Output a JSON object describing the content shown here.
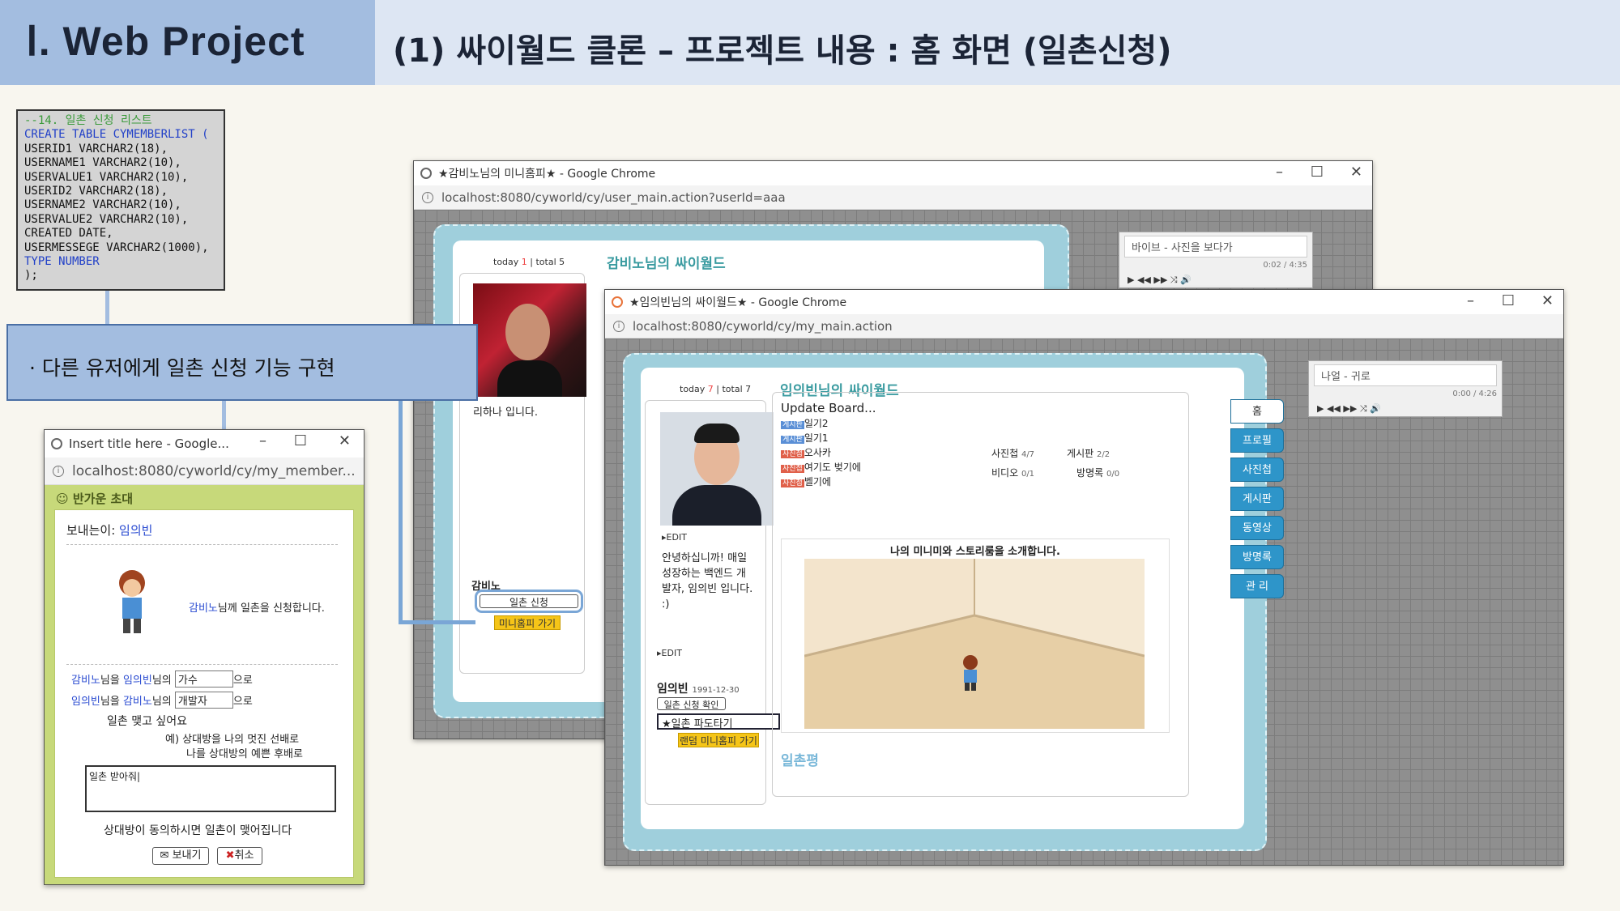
{
  "header": {
    "section": "Ⅰ. Web Project",
    "title": "(1) 싸이월드 클론 – 프로젝트 내용 : 홈 화면 (일촌신청)"
  },
  "sql": {
    "lines": [
      "--14. 일촌 신청 리스트",
      "CREATE TABLE CYMEMBERLIST (",
      "USERID1 VARCHAR2(18),",
      "USERNAME1 VARCHAR2(10),",
      "USERVALUE1 VARCHAR2(10),",
      "USERID2 VARCHAR2(18),",
      "USERNAME2 VARCHAR2(10),",
      "USERVALUE2 VARCHAR2(10),",
      "CREATED DATE,",
      "USERMESSEGE VARCHAR2(1000),",
      "TYPE NUMBER",
      ");"
    ]
  },
  "callout": {
    "text": "· 다른 유저에게 일촌 신청 기능 구현"
  },
  "popup": {
    "title": "Insert title here - Google...",
    "url": "localhost:8080/cyworld/cy/my_member...",
    "heading": "반가운 초대",
    "sender_label": "보내는이:",
    "sender_name": "임의빈",
    "invite_text": "님께 일촌을 신청합니다.",
    "invite_target": "감비노",
    "row1": {
      "a": "감비노",
      "a_suffix": "님을",
      "b": "임의빈",
      "b_suffix": "님의",
      "value": "가수",
      "tail": "으로"
    },
    "row2": {
      "a": "임의빈",
      "a_suffix": "님을",
      "b": "감비노",
      "b_suffix": "님의",
      "value": "개발자",
      "tail": "으로"
    },
    "want": "일촌 맺고 싶어요",
    "example1": "예) 상대방을 나의 멋진 선배로",
    "example2": "나를 상대방의 예쁜 후배로",
    "message": "일촌 받아줘|",
    "note": "상대방이 동의하시면 일촌이 맺어집니다",
    "send": "보내기",
    "cancel": "취소"
  },
  "win_back": {
    "title": "★감비노님의 미니홈피★ - Google Chrome",
    "url": "localhost:8080/cyworld/cy/user_main.action?userId=aaa",
    "today_label": "today",
    "today": "1",
    "total_label": "total",
    "total": "5",
    "home_title": "감비노님의 싸이월드",
    "intro": "리하나 입니다.",
    "name": "감비노",
    "ilchon_btn": "일촌 신청",
    "mini_btn": "미니홈피 가기",
    "song": "바이브 - 사진을 보다가",
    "time": "0:02 / 4:35"
  },
  "win_front": {
    "title": "★임의빈님의 싸이월드★ - Google Chrome",
    "url": "localhost:8080/cyworld/cy/my_main.action",
    "today_label": "today",
    "today": "7",
    "total_label": "total",
    "total": "7",
    "home_title": "임의빈님의 싸이월드",
    "edit": "EDIT",
    "intro": "안녕하십니까! 매일 성장하는 백엔드 개발자, 임의빈 입니다. :)",
    "name": "임의빈",
    "birth": "1991-12-30",
    "check_btn": "일촌 신청 확인",
    "select": "★일촌 파도타기",
    "random_btn": "랜덤 미니홈피 가기",
    "update_title": "Update Board...",
    "updates": [
      {
        "tag": "게시판",
        "text": "일기2",
        "color": "#5a8fd6"
      },
      {
        "tag": "게시판",
        "text": "일기1",
        "color": "#5a8fd6"
      },
      {
        "tag": "사진첩",
        "text": "오사카",
        "color": "#e0604a"
      },
      {
        "tag": "사진첩",
        "text": "여기도 벚기에",
        "color": "#e0604a"
      },
      {
        "tag": "사진첩",
        "text": "벨기에",
        "color": "#e0604a"
      }
    ],
    "stats": [
      {
        "label": "사진첩",
        "value": "4/7"
      },
      {
        "label": "게시판",
        "value": "2/2"
      },
      {
        "label": "비디오",
        "value": "0/1"
      },
      {
        "label": "방명록",
        "value": "0/0"
      }
    ],
    "story": "나의 미니미와 스토리룸을 소개합니다.",
    "ilchon_title": "일촌평",
    "tabs": [
      "홈",
      "프로필",
      "사진첩",
      "게시판",
      "동영상",
      "방명록",
      "관 리"
    ],
    "song": "나얼 - 귀로",
    "time": "0:00 / 4:26"
  }
}
